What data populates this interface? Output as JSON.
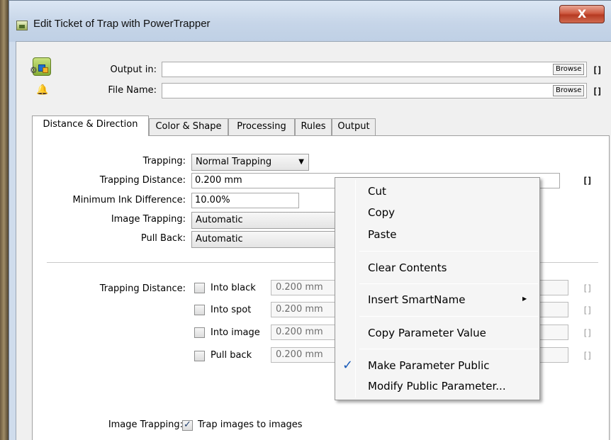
{
  "window": {
    "title": "Edit Ticket of Trap with PowerTrapper",
    "close_label": "X"
  },
  "top_fields": {
    "output_in": {
      "label": "Output in:",
      "value": "",
      "browse_label": "Browse",
      "bracket": "[]"
    },
    "file_name": {
      "label": "File Name:",
      "value": "",
      "browse_label": "Browse",
      "bracket": "[]"
    }
  },
  "tabs": [
    {
      "label": "Distance & Direction",
      "active": true
    },
    {
      "label": "Color & Shape",
      "active": false
    },
    {
      "label": "Processing",
      "active": false
    },
    {
      "label": "Rules",
      "active": false
    },
    {
      "label": "Output",
      "active": false
    }
  ],
  "form": {
    "trapping": {
      "label": "Trapping:",
      "value": "Normal Trapping"
    },
    "trapping_distance": {
      "label": "Trapping Distance:",
      "value": "0.200 mm",
      "bracket": "[]"
    },
    "min_ink_difference": {
      "label": "Minimum Ink Difference:",
      "value": "10.00%"
    },
    "image_trapping": {
      "label": "Image Trapping:",
      "value": "Automatic"
    },
    "pull_back": {
      "label": "Pull Back:",
      "value": "Automatic"
    }
  },
  "distance_section": {
    "label": "Trapping Distance:",
    "rows": [
      {
        "label": "Into black",
        "value": "0.200 mm",
        "checked": false,
        "bracket": "[]"
      },
      {
        "label": "Into spot",
        "value": "0.200 mm",
        "checked": false,
        "bracket": "[]"
      },
      {
        "label": "Into image",
        "value": "0.200 mm",
        "checked": false,
        "bracket": "[]"
      },
      {
        "label": "Pull back",
        "value": "0.200 mm",
        "checked": false,
        "bracket": "[]"
      }
    ]
  },
  "image_trapping_section": {
    "label": "Image Trapping:",
    "checkbox_label": "Trap images to images",
    "checked": true
  },
  "context_menu": {
    "items": [
      {
        "label": "Cut"
      },
      {
        "label": "Copy"
      },
      {
        "label": "Paste"
      },
      {
        "label": "Clear Contents"
      },
      {
        "label": "Insert SmartName",
        "submenu": true
      },
      {
        "label": "Copy Parameter Value"
      },
      {
        "label": "Make Parameter Public",
        "checked": true
      },
      {
        "label": "Modify Public Parameter..."
      }
    ],
    "check_glyph": "✓",
    "submenu_glyph": "▶"
  },
  "icons": [
    "app-icon",
    "gear-icon",
    "bell-icon",
    "ticket-icon",
    "dropdown-arrow-icon",
    "check-icon",
    "submenu-arrow-icon"
  ]
}
